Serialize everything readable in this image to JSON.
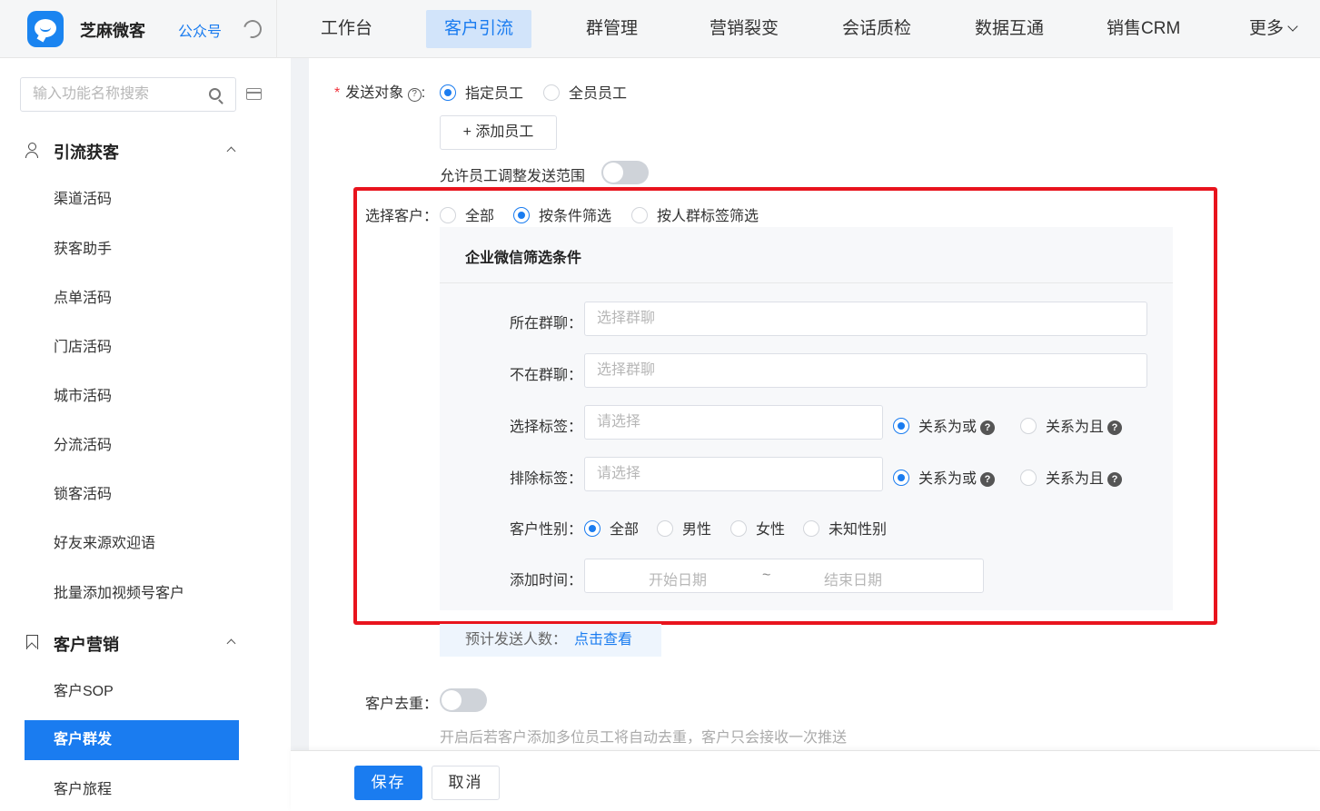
{
  "brand": {
    "name": "芝麻微客",
    "link": "公众号",
    "logo_icon": "chat-bubble-icon",
    "theme_icon": "moon-icon"
  },
  "nav": {
    "items": [
      {
        "label": "工作台",
        "active": false
      },
      {
        "label": "客户引流",
        "active": true
      },
      {
        "label": "群管理",
        "active": false
      },
      {
        "label": "营销裂变",
        "active": false
      },
      {
        "label": "会话质检",
        "active": false
      },
      {
        "label": "数据互通",
        "active": false
      },
      {
        "label": "销售CRM",
        "active": false
      },
      {
        "label": "更多",
        "active": false
      }
    ]
  },
  "sidebar": {
    "search_placeholder": "输入功能名称搜索",
    "groups": [
      {
        "title": "引流获客",
        "icon": "user-add-icon",
        "items": [
          "渠道活码",
          "获客助手",
          "点单活码",
          "门店活码",
          "城市活码",
          "分流活码",
          "锁客活码",
          "好友来源欢迎语",
          "批量添加视频号客户"
        ]
      },
      {
        "title": "客户营销",
        "icon": "bookmark-icon",
        "items": [
          "客户SOP",
          "客户群发",
          "客户旅程"
        ],
        "active_item": "客户群发"
      }
    ]
  },
  "form": {
    "send_target": {
      "label": "发送对象",
      "colon": ":",
      "options": [
        {
          "label": "指定员工",
          "selected": true
        },
        {
          "label": "全员员工",
          "selected": false
        }
      ],
      "add_button": "添加员工",
      "add_icon": "+",
      "allow_adjust_label": "允许员工调整发送范围",
      "allow_adjust_on": false
    },
    "select_customer": {
      "label": "选择客户：",
      "options": [
        {
          "label": "全部",
          "selected": false
        },
        {
          "label": "按条件筛选",
          "selected": true
        },
        {
          "label": "按人群标签筛选",
          "selected": false
        }
      ]
    },
    "filter": {
      "title": "企业微信筛选条件",
      "in_group": {
        "label": "所在群聊：",
        "placeholder": "选择群聊"
      },
      "not_in_group": {
        "label": "不在群聊：",
        "placeholder": "选择群聊"
      },
      "select_tag": {
        "label": "选择标签：",
        "placeholder": "请选择",
        "relations": [
          {
            "label": "关系为或",
            "selected": true
          },
          {
            "label": "关系为且",
            "selected": false
          }
        ]
      },
      "exclude_tag": {
        "label": "排除标签：",
        "placeholder": "请选择",
        "relations": [
          {
            "label": "关系为或",
            "selected": true
          },
          {
            "label": "关系为且",
            "selected": false
          }
        ]
      },
      "gender": {
        "label": "客户性别：",
        "options": [
          {
            "label": "全部",
            "selected": true
          },
          {
            "label": "男性",
            "selected": false
          },
          {
            "label": "女性",
            "selected": false
          },
          {
            "label": "未知性别",
            "selected": false
          }
        ]
      },
      "add_time": {
        "label": "添加时间：",
        "start": "开始日期",
        "sep": "~",
        "end": "结束日期"
      }
    },
    "estimate": {
      "label": "预计发送人数：",
      "link": "点击查看"
    },
    "dedupe": {
      "label": "客户去重：",
      "on": false,
      "hint": "开启后若客户添加多位员工将自动去重，客户只会接收一次推送"
    }
  },
  "footer": {
    "save": "保存",
    "cancel": "取消"
  },
  "colors": {
    "accent": "#1a7cf0",
    "highlight_box": "#e8141d"
  }
}
